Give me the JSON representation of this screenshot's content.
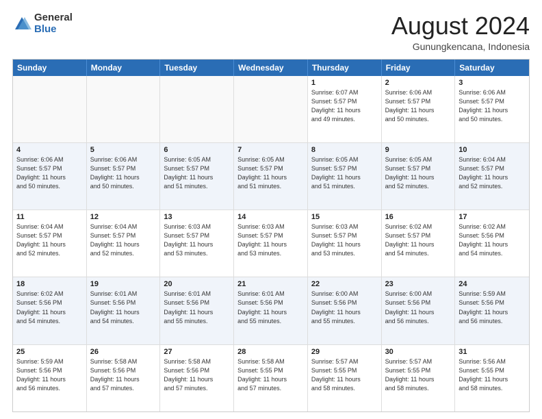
{
  "logo": {
    "general": "General",
    "blue": "Blue"
  },
  "title": "August 2024",
  "location": "Gunungkencana, Indonesia",
  "weekdays": [
    "Sunday",
    "Monday",
    "Tuesday",
    "Wednesday",
    "Thursday",
    "Friday",
    "Saturday"
  ],
  "rows": [
    [
      {
        "day": "",
        "info": ""
      },
      {
        "day": "",
        "info": ""
      },
      {
        "day": "",
        "info": ""
      },
      {
        "day": "",
        "info": ""
      },
      {
        "day": "1",
        "info": "Sunrise: 6:07 AM\nSunset: 5:57 PM\nDaylight: 11 hours\nand 49 minutes."
      },
      {
        "day": "2",
        "info": "Sunrise: 6:06 AM\nSunset: 5:57 PM\nDaylight: 11 hours\nand 50 minutes."
      },
      {
        "day": "3",
        "info": "Sunrise: 6:06 AM\nSunset: 5:57 PM\nDaylight: 11 hours\nand 50 minutes."
      }
    ],
    [
      {
        "day": "4",
        "info": "Sunrise: 6:06 AM\nSunset: 5:57 PM\nDaylight: 11 hours\nand 50 minutes."
      },
      {
        "day": "5",
        "info": "Sunrise: 6:06 AM\nSunset: 5:57 PM\nDaylight: 11 hours\nand 50 minutes."
      },
      {
        "day": "6",
        "info": "Sunrise: 6:05 AM\nSunset: 5:57 PM\nDaylight: 11 hours\nand 51 minutes."
      },
      {
        "day": "7",
        "info": "Sunrise: 6:05 AM\nSunset: 5:57 PM\nDaylight: 11 hours\nand 51 minutes."
      },
      {
        "day": "8",
        "info": "Sunrise: 6:05 AM\nSunset: 5:57 PM\nDaylight: 11 hours\nand 51 minutes."
      },
      {
        "day": "9",
        "info": "Sunrise: 6:05 AM\nSunset: 5:57 PM\nDaylight: 11 hours\nand 52 minutes."
      },
      {
        "day": "10",
        "info": "Sunrise: 6:04 AM\nSunset: 5:57 PM\nDaylight: 11 hours\nand 52 minutes."
      }
    ],
    [
      {
        "day": "11",
        "info": "Sunrise: 6:04 AM\nSunset: 5:57 PM\nDaylight: 11 hours\nand 52 minutes."
      },
      {
        "day": "12",
        "info": "Sunrise: 6:04 AM\nSunset: 5:57 PM\nDaylight: 11 hours\nand 52 minutes."
      },
      {
        "day": "13",
        "info": "Sunrise: 6:03 AM\nSunset: 5:57 PM\nDaylight: 11 hours\nand 53 minutes."
      },
      {
        "day": "14",
        "info": "Sunrise: 6:03 AM\nSunset: 5:57 PM\nDaylight: 11 hours\nand 53 minutes."
      },
      {
        "day": "15",
        "info": "Sunrise: 6:03 AM\nSunset: 5:57 PM\nDaylight: 11 hours\nand 53 minutes."
      },
      {
        "day": "16",
        "info": "Sunrise: 6:02 AM\nSunset: 5:57 PM\nDaylight: 11 hours\nand 54 minutes."
      },
      {
        "day": "17",
        "info": "Sunrise: 6:02 AM\nSunset: 5:56 PM\nDaylight: 11 hours\nand 54 minutes."
      }
    ],
    [
      {
        "day": "18",
        "info": "Sunrise: 6:02 AM\nSunset: 5:56 PM\nDaylight: 11 hours\nand 54 minutes."
      },
      {
        "day": "19",
        "info": "Sunrise: 6:01 AM\nSunset: 5:56 PM\nDaylight: 11 hours\nand 54 minutes."
      },
      {
        "day": "20",
        "info": "Sunrise: 6:01 AM\nSunset: 5:56 PM\nDaylight: 11 hours\nand 55 minutes."
      },
      {
        "day": "21",
        "info": "Sunrise: 6:01 AM\nSunset: 5:56 PM\nDaylight: 11 hours\nand 55 minutes."
      },
      {
        "day": "22",
        "info": "Sunrise: 6:00 AM\nSunset: 5:56 PM\nDaylight: 11 hours\nand 55 minutes."
      },
      {
        "day": "23",
        "info": "Sunrise: 6:00 AM\nSunset: 5:56 PM\nDaylight: 11 hours\nand 56 minutes."
      },
      {
        "day": "24",
        "info": "Sunrise: 5:59 AM\nSunset: 5:56 PM\nDaylight: 11 hours\nand 56 minutes."
      }
    ],
    [
      {
        "day": "25",
        "info": "Sunrise: 5:59 AM\nSunset: 5:56 PM\nDaylight: 11 hours\nand 56 minutes."
      },
      {
        "day": "26",
        "info": "Sunrise: 5:58 AM\nSunset: 5:56 PM\nDaylight: 11 hours\nand 57 minutes."
      },
      {
        "day": "27",
        "info": "Sunrise: 5:58 AM\nSunset: 5:56 PM\nDaylight: 11 hours\nand 57 minutes."
      },
      {
        "day": "28",
        "info": "Sunrise: 5:58 AM\nSunset: 5:55 PM\nDaylight: 11 hours\nand 57 minutes."
      },
      {
        "day": "29",
        "info": "Sunrise: 5:57 AM\nSunset: 5:55 PM\nDaylight: 11 hours\nand 58 minutes."
      },
      {
        "day": "30",
        "info": "Sunrise: 5:57 AM\nSunset: 5:55 PM\nDaylight: 11 hours\nand 58 minutes."
      },
      {
        "day": "31",
        "info": "Sunrise: 5:56 AM\nSunset: 5:55 PM\nDaylight: 11 hours\nand 58 minutes."
      }
    ]
  ]
}
